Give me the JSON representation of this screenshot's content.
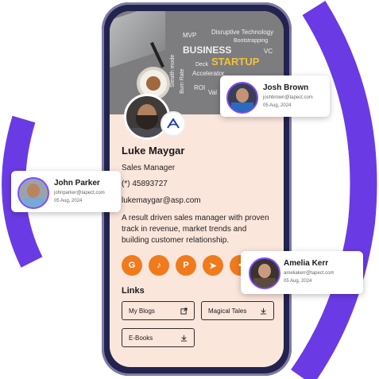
{
  "colors": {
    "accent": "#6a3be4",
    "social": "#f07b1d",
    "screen_bg": "#fbe6dc",
    "phone_frame": "#22234e"
  },
  "cover": {
    "words": [
      "Disruptive Technology",
      "Bootstrapping",
      "MVP",
      "BUSINESS",
      "STARTUP",
      "VC",
      "Deck",
      "Burn Rate",
      "Stealth mode",
      "Accelerator",
      "ROI",
      "Val"
    ]
  },
  "profile": {
    "name": "Luke Maygar",
    "title": "Sales Manager",
    "phone": "(*) 45893727",
    "email": "lukemaygar@asp.com",
    "bio": "A result driven sales manager with proven track in revenue, market trends and building customer relationship."
  },
  "socials": [
    {
      "icon": "google-icon",
      "glyph": "G"
    },
    {
      "icon": "tiktok-icon",
      "glyph": "♪"
    },
    {
      "icon": "pinterest-icon",
      "glyph": "P"
    },
    {
      "icon": "telegram-icon",
      "glyph": "➤"
    },
    {
      "icon": "more-icon",
      "glyph": "•"
    }
  ],
  "links": {
    "heading": "Links",
    "items": [
      {
        "label": "My Blogs",
        "icon": "external-link-icon"
      },
      {
        "label": "Magical Tales",
        "icon": "download-icon"
      },
      {
        "label": "E-Books",
        "icon": "download-icon"
      }
    ]
  },
  "contacts": [
    {
      "name": "Josh Brown",
      "email": "joshbrown@tapect.com",
      "date": "05 Aug, 2024"
    },
    {
      "name": "John Parker",
      "email": "johnparker@tapect.com",
      "date": "05 Aug, 2024"
    },
    {
      "name": "Amelia Kerr",
      "email": "ameliakerr@tapect.com",
      "date": "05 Aug, 2024"
    }
  ]
}
